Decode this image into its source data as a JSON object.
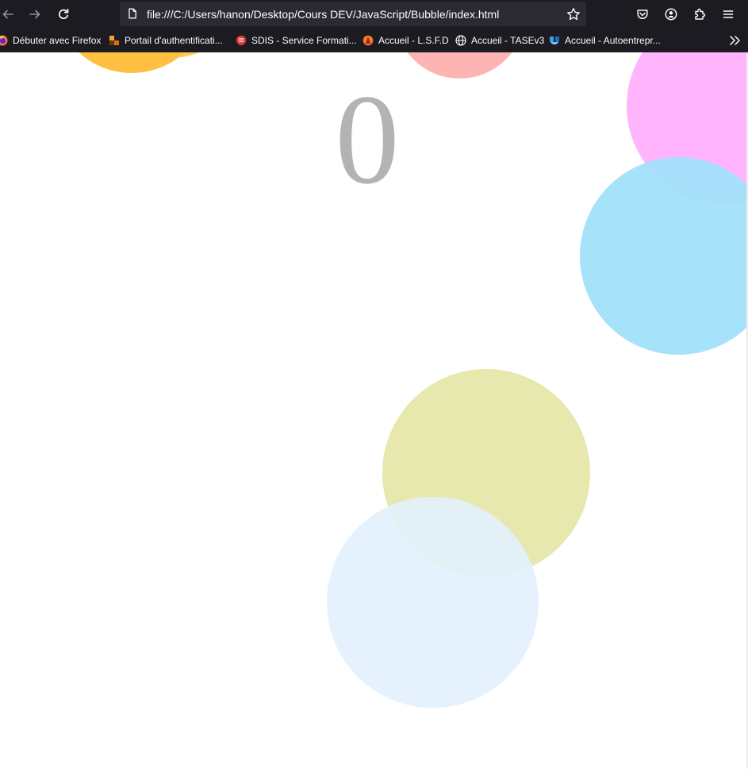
{
  "browser": {
    "url": "file:///C:/Users/hanon/Desktop/Cours DEV/JavaScript/Bubble/index.html",
    "icons": {
      "back": "arrow-left-icon",
      "forward": "arrow-right-icon",
      "reload": "reload-icon",
      "page": "page-icon",
      "bookmark_star": "star-icon",
      "pocket": "pocket-icon",
      "account": "account-icon",
      "extensions": "extensions-icon",
      "menu": "menu-icon"
    },
    "bookmarks": [
      {
        "label": "Débuter avec Firefox",
        "icon": "firefox-icon"
      },
      {
        "label": "Portail d'authentificati...",
        "icon": "portal-icon"
      },
      {
        "label": "SDIS - Service Formati...",
        "icon": "sdis-icon"
      },
      {
        "label": "Accueil - L.S.F.D",
        "icon": "lsfd-icon"
      },
      {
        "label": "Accueil - TASEv3",
        "icon": "globe-icon"
      },
      {
        "label": "Accueil - Autoentrepr...",
        "icon": "autoentrepreneur-icon"
      }
    ],
    "bookmarks_more_icon": "chevrons-right-icon"
  },
  "game": {
    "score": "0",
    "bubble_colors": [
      "#ffbf40",
      "#ffb4b4",
      "#ffb4fb",
      "#a3e1fb",
      "#e6e8ae",
      "#e2f1fd"
    ]
  }
}
